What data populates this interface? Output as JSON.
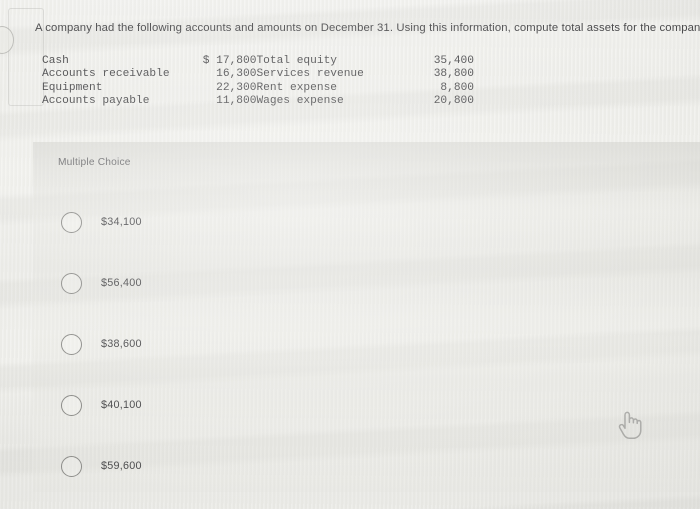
{
  "question": {
    "prompt": "A company had the following accounts and amounts on December 31. Using this information, compute total assets for the company."
  },
  "accounts_table": {
    "rows": [
      {
        "name_left": "Cash",
        "value_left": "$ 17,800",
        "name_right": "Total equity",
        "value_right": "35,400"
      },
      {
        "name_left": "Accounts receivable",
        "value_left": "16,300",
        "name_right": "Services revenue",
        "value_right": "38,800"
      },
      {
        "name_left": "Equipment",
        "value_left": "22,300",
        "name_right": "Rent expense",
        "value_right": "8,800"
      },
      {
        "name_left": "Accounts payable",
        "value_left": "11,800",
        "name_right": "Wages expense",
        "value_right": "20,800"
      }
    ]
  },
  "answer_card": {
    "type_label": "Multiple Choice",
    "options": [
      {
        "label": "$34,100",
        "selected": false
      },
      {
        "label": "$56,400",
        "selected": false
      },
      {
        "label": "$38,600",
        "selected": false
      },
      {
        "label": "$40,100",
        "selected": false
      },
      {
        "label": "$59,600",
        "selected": false
      }
    ]
  },
  "cursor": {
    "type": "pointing-hand"
  },
  "colors": {
    "page_background": "#eeeeea",
    "card_background": "#e2e2dd",
    "body_text": "#4b4b4d",
    "muted_text": "#6f6f71",
    "radio_border": "#8d8d8a"
  }
}
